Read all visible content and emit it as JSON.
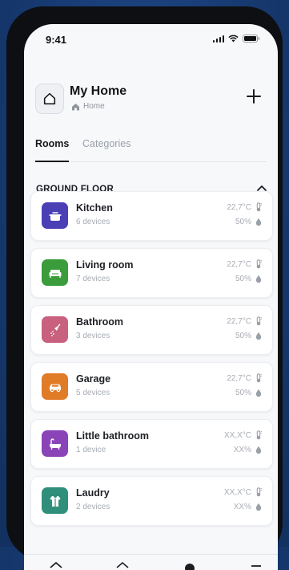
{
  "status_bar": {
    "time": "9:41"
  },
  "header": {
    "title": "My Home",
    "subtitle": "Home"
  },
  "tabs": [
    {
      "label": "Rooms",
      "active": true
    },
    {
      "label": "Categories",
      "active": false
    }
  ],
  "section": {
    "title": "GROUND FLOOR"
  },
  "rooms": [
    {
      "name": "Kitchen",
      "devices": "6 devices",
      "temp": "22,7°C",
      "humidity": "50%",
      "color": "#4a3fb5",
      "icon": "pot-icon"
    },
    {
      "name": "Living room",
      "devices": "7 devices",
      "temp": "22,7°C",
      "humidity": "50%",
      "color": "#3a9c3a",
      "icon": "sofa-icon"
    },
    {
      "name": "Bathroom",
      "devices": "3 devices",
      "temp": "22,7°C",
      "humidity": "50%",
      "color": "#c8607e",
      "icon": "shower-icon"
    },
    {
      "name": "Garage",
      "devices": "5 devices",
      "temp": "22,7°C",
      "humidity": "50%",
      "color": "#e07b28",
      "icon": "car-icon"
    },
    {
      "name": "Little bathroom",
      "devices": "1 device",
      "temp": "XX,X°C",
      "humidity": "XX%",
      "color": "#8a44b8",
      "icon": "bathtub-icon"
    },
    {
      "name": "Laudry",
      "devices": "2 devices",
      "temp": "XX,X°C",
      "humidity": "XX%",
      "color": "#2f8f7a",
      "icon": "laundry-icon"
    }
  ]
}
